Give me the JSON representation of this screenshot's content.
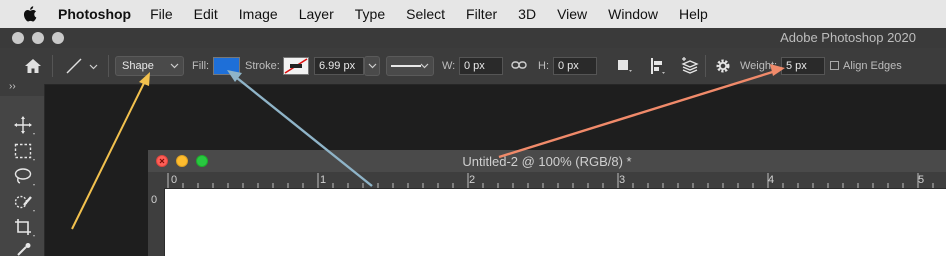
{
  "menubar": {
    "items": [
      "Photoshop",
      "File",
      "Edit",
      "Image",
      "Layer",
      "Type",
      "Select",
      "Filter",
      "3D",
      "View",
      "Window",
      "Help"
    ]
  },
  "window": {
    "title": "Adobe Photoshop 2020"
  },
  "options": {
    "mode": "Shape",
    "fill_label": "Fill:",
    "fill_color": "#1e6fd8",
    "stroke_label": "Stroke:",
    "stroke_width": "6.99 px",
    "w_label": "W:",
    "w_value": "0 px",
    "h_label": "H:",
    "h_value": "0 px",
    "weight_label": "Weight:",
    "weight_value": "5 px",
    "align_edges_label": "Align Edges"
  },
  "document": {
    "title": "Untitled-2 @ 100% (RGB/8) *",
    "ruler_h": [
      "0",
      "1",
      "2",
      "3",
      "4",
      "5"
    ],
    "ruler_v": [
      "0"
    ]
  },
  "annotation_colors": {
    "yellow": "#f2c14e",
    "blue": "#8fb4c8",
    "orange": "#f08a6a"
  }
}
